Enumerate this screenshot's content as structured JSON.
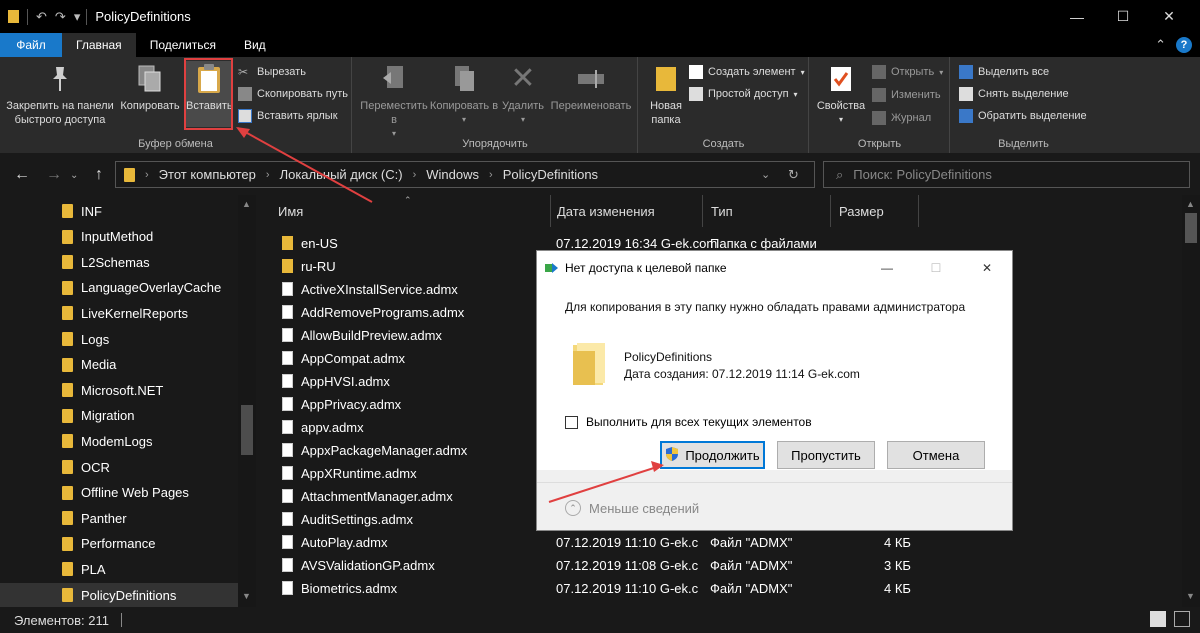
{
  "window": {
    "title": "PolicyDefinitions"
  },
  "menu": {
    "file": "Файл",
    "tabs": [
      "Главная",
      "Поделиться",
      "Вид"
    ]
  },
  "ribbon": {
    "clipboard": {
      "pin": "Закрепить на панели быстрого доступа",
      "copy": "Копировать",
      "paste": "Вставить",
      "cut": "Вырезать",
      "copy_path": "Скопировать путь",
      "paste_shortcut": "Вставить ярлык",
      "label": "Буфер обмена"
    },
    "organize": {
      "move": "Переместить в",
      "copy_to": "Копировать в",
      "delete": "Удалить",
      "rename": "Переименовать",
      "label": "Упорядочить"
    },
    "create": {
      "new_folder": "Новая папка",
      "new_item": "Создать элемент",
      "easy_access": "Простой доступ",
      "label": "Создать"
    },
    "open": {
      "properties": "Свойства",
      "open": "Открыть",
      "edit": "Изменить",
      "history": "Журнал",
      "label": "Открыть"
    },
    "select": {
      "select_all": "Выделить все",
      "select_none": "Снять выделение",
      "invert": "Обратить выделение",
      "label": "Выделить"
    }
  },
  "address": {
    "crumbs": [
      "Этот компьютер",
      "Локальный диск (C:)",
      "Windows",
      "PolicyDefinitions"
    ],
    "search_placeholder": "Поиск: PolicyDefinitions"
  },
  "nav": {
    "items": [
      "INF",
      "InputMethod",
      "L2Schemas",
      "LanguageOverlayCache",
      "LiveKernelReports",
      "Logs",
      "Media",
      "Microsoft.NET",
      "Migration",
      "ModemLogs",
      "OCR",
      "Offline Web Pages",
      "Panther",
      "Performance",
      "PLA",
      "PolicyDefinitions"
    ],
    "selected": "PolicyDefinitions"
  },
  "columns": {
    "name": "Имя",
    "date": "Дата изменения",
    "type": "Тип",
    "size": "Размер"
  },
  "files": [
    {
      "name": "en-US",
      "date": "07.12.2019 16:34 G-ek.com",
      "type": "Папка с файлами",
      "size": "",
      "folder": true
    },
    {
      "name": "ru-RU",
      "date": "",
      "type": "",
      "size": "",
      "folder": true
    },
    {
      "name": "ActiveXInstallService.admx",
      "date": "",
      "type": "",
      "size": ""
    },
    {
      "name": "AddRemovePrograms.admx",
      "date": "",
      "type": "",
      "size": ""
    },
    {
      "name": "AllowBuildPreview.admx",
      "date": "",
      "type": "",
      "size": ""
    },
    {
      "name": "AppCompat.admx",
      "date": "",
      "type": "",
      "size": ""
    },
    {
      "name": "AppHVSI.admx",
      "date": "",
      "type": "",
      "size": ""
    },
    {
      "name": "AppPrivacy.admx",
      "date": "",
      "type": "",
      "size": ""
    },
    {
      "name": "appv.admx",
      "date": "",
      "type": "",
      "size": ""
    },
    {
      "name": "AppxPackageManager.admx",
      "date": "",
      "type": "",
      "size": ""
    },
    {
      "name": "AppXRuntime.admx",
      "date": "",
      "type": "",
      "size": ""
    },
    {
      "name": "AttachmentManager.admx",
      "date": "",
      "type": "",
      "size": ""
    },
    {
      "name": "AuditSettings.admx",
      "date": "",
      "type": "",
      "size": ""
    },
    {
      "name": "AutoPlay.admx",
      "date": "07.12.2019 11:10 G-ek.c",
      "type": "Файл \"ADMX\"",
      "size": "4 КБ"
    },
    {
      "name": "AVSValidationGP.admx",
      "date": "07.12.2019 11:08 G-ek.c",
      "type": "Файл \"ADMX\"",
      "size": "3 КБ"
    },
    {
      "name": "Biometrics.admx",
      "date": "07.12.2019 11:10 G-ek.c",
      "type": "Файл \"ADMX\"",
      "size": "4 КБ"
    }
  ],
  "status": {
    "count": "Элементов: 211"
  },
  "dialog": {
    "title": "Нет доступа к целевой папке",
    "message": "Для копирования в эту папку нужно обладать правами администратора",
    "folder_name": "PolicyDefinitions",
    "folder_created": "Дата создания: 07.12.2019 11:14 G-ek.com",
    "checkbox": "Выполнить для всех текущих элементов",
    "continue": "Продолжить",
    "skip": "Пропустить",
    "cancel": "Отмена",
    "less": "Меньше сведений"
  },
  "colors": {
    "accent": "#1979ca",
    "folder": "#e8b83a",
    "annotation": "#e04040"
  }
}
